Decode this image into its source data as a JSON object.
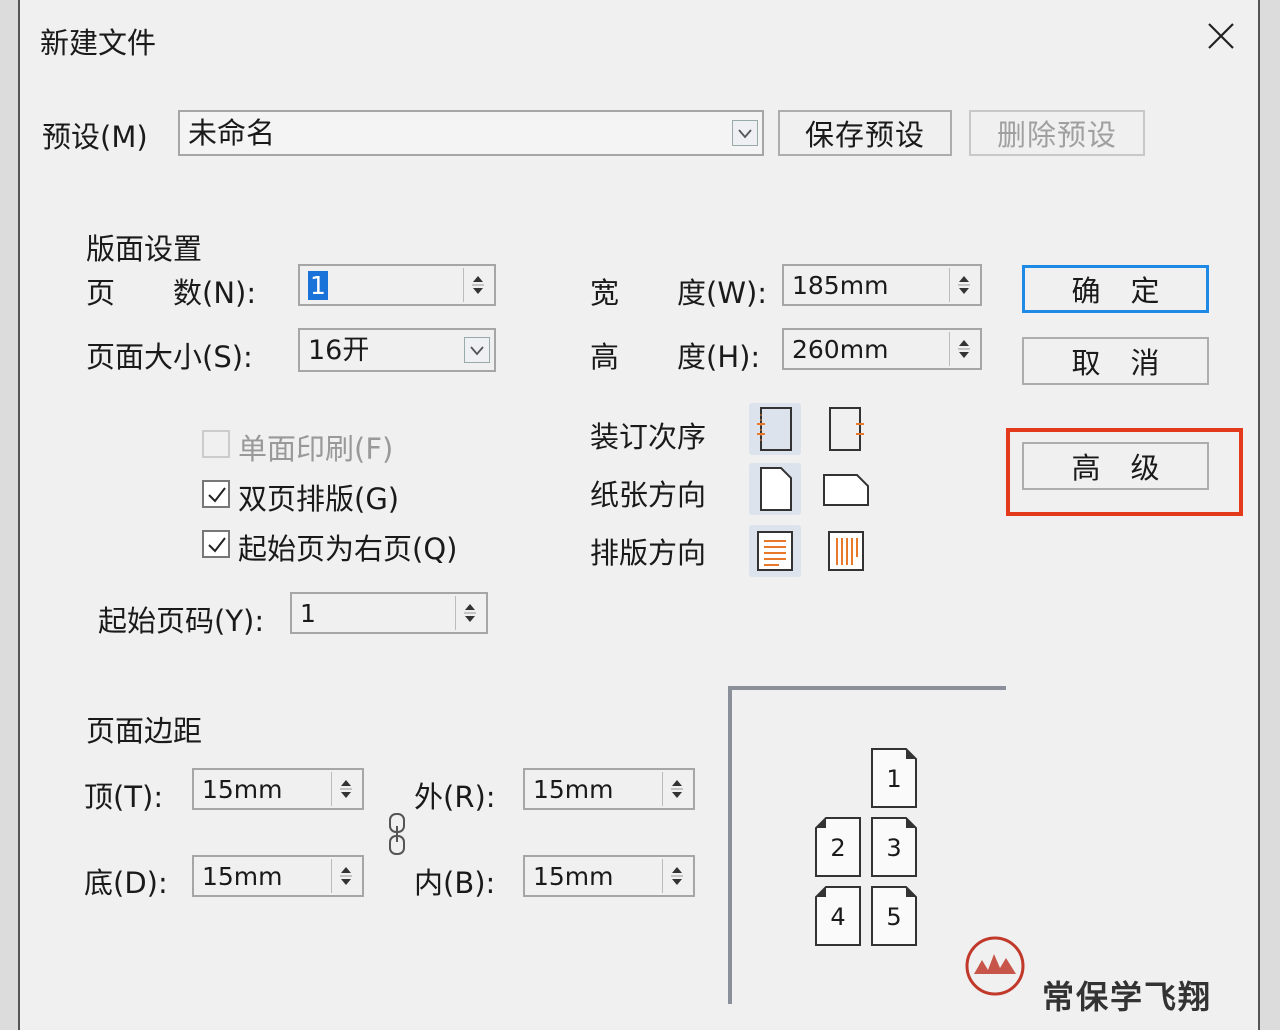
{
  "dialog": {
    "title": "新建文件"
  },
  "preset": {
    "label": "预设(M)",
    "value": "未命名",
    "save_button": "保存预设",
    "delete_button": "删除预设"
  },
  "layout": {
    "section_title": "版面设置",
    "pages_label": "页　　数(N):",
    "pages_value": "1",
    "page_size_label": "页面大小(S):",
    "page_size_value": "16开",
    "width_label": "宽　　度(W):",
    "width_value": "185mm",
    "height_label": "高　　度(H):",
    "height_value": "260mm",
    "single_side_label": "单面印刷(F)",
    "facing_pages_label": "双页排版(G)",
    "start_right_label": "起始页为右页(Q)",
    "binding_label": "装订次序",
    "orientation_label": "纸张方向",
    "text_direction_label": "排版方向",
    "start_page_label": "起始页码(Y):",
    "start_page_value": "1"
  },
  "margins": {
    "section_title": "页面边距",
    "top_label": "顶(T):",
    "top_value": "15mm",
    "bottom_label": "底(D):",
    "bottom_value": "15mm",
    "outer_label": "外(R):",
    "outer_value": "15mm",
    "inner_label": "内(B):",
    "inner_value": "15mm"
  },
  "buttons": {
    "ok": "确定",
    "cancel": "取消",
    "advanced": "高级"
  },
  "preview": {
    "pages": [
      "1",
      "2",
      "3",
      "4",
      "5"
    ]
  },
  "watermark": {
    "text": "常保学飞翔"
  },
  "colors": {
    "accent_blue": "#1e8ae6",
    "highlight_red": "#e23a1a",
    "icon_orange": "#e8782a"
  }
}
